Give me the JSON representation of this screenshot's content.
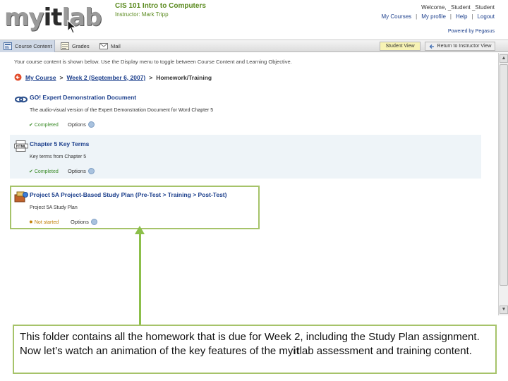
{
  "header": {
    "logo_my": "my",
    "logo_it": "it",
    "logo_lab": "lab",
    "course_title": "CIS 101 Intro to Computers",
    "instructor": "Instructor: Mark Tripp",
    "welcome": "Welcome, _Student _Student",
    "links": [
      "My Courses",
      "My profile",
      "Help",
      "Logout"
    ],
    "link_separator": "|",
    "powered_by": "Powered by Pegasus"
  },
  "tabs": [
    {
      "label": "Course Content",
      "icon": "course-content-icon"
    },
    {
      "label": "Grades",
      "icon": "grades-icon"
    },
    {
      "label": "Mail",
      "icon": "mail-icon"
    }
  ],
  "views": {
    "student_view": "Student View",
    "return_view": "Return to Instructor View"
  },
  "main": {
    "intro": "Your course content is shown below. Use the Display menu to toggle between Course Content and Learning Objective.",
    "breadcrumb": {
      "my_course": "My Course",
      "sep": ">",
      "week": "Week 2 (September 6, 2007)",
      "current": "Homework/Training"
    },
    "items": [
      {
        "title": "GO! Expert Demonstration Document",
        "description": "The audio-visual version of the Expert Demonstration Document for Word Chapter 5",
        "status": "Completed",
        "options": "Options",
        "icon": "link-icon"
      },
      {
        "title": "Chapter 5 Key Terms",
        "description": "Key terms from Chapter 5",
        "status": "Completed",
        "options": "Options",
        "icon": "html-document-icon"
      },
      {
        "title": "Project 5A Project-Based Study Plan (Pre-Test > Training > Post-Test)",
        "description": "Project 5A Study Plan",
        "status": "Not started",
        "options": "Options",
        "icon": "study-plan-icon"
      }
    ]
  },
  "callout": {
    "text_before": "This folder contains all the homework that is due for Week 2, including the Study Plan assignment. Now let’s watch an animation of the key features of the my",
    "text_bold": "it",
    "text_after": "lab assessment and training content."
  },
  "colors": {
    "accent_green": "#8cc63f",
    "link_blue": "#1c3f8c",
    "callout_border": "#a6c36a"
  }
}
